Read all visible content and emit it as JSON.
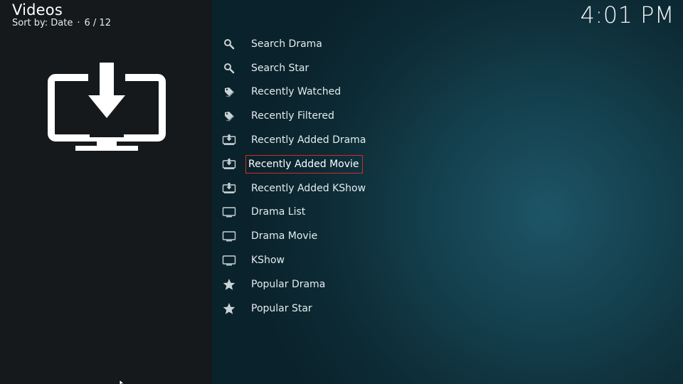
{
  "header": {
    "title": "Videos",
    "sort_label": "Sort by: Date",
    "position": "6 / 12",
    "separator": "·"
  },
  "clock": "4:01 PM",
  "poster": {
    "icon": "download-monitor-icon"
  },
  "menu": {
    "selected_index": 5,
    "items": [
      {
        "label": "Search Drama",
        "icon": "search-icon"
      },
      {
        "label": "Search Star",
        "icon": "search-icon"
      },
      {
        "label": "Recently Watched",
        "icon": "tag-icon"
      },
      {
        "label": "Recently Filtered",
        "icon": "tag-icon"
      },
      {
        "label": "Recently Added Drama",
        "icon": "download-monitor-icon"
      },
      {
        "label": "Recently Added Movie",
        "icon": "download-monitor-icon"
      },
      {
        "label": "Recently Added KShow",
        "icon": "download-monitor-icon"
      },
      {
        "label": "Drama List",
        "icon": "monitor-icon"
      },
      {
        "label": "Drama Movie",
        "icon": "monitor-icon"
      },
      {
        "label": "KShow",
        "icon": "monitor-icon"
      },
      {
        "label": "Popular Drama",
        "icon": "star-icon"
      },
      {
        "label": "Popular Star",
        "icon": "star-icon"
      }
    ]
  },
  "colors": {
    "focus_border": "#d22a2a",
    "left_panel": "#15191b",
    "accent_background": "#1d5566"
  }
}
